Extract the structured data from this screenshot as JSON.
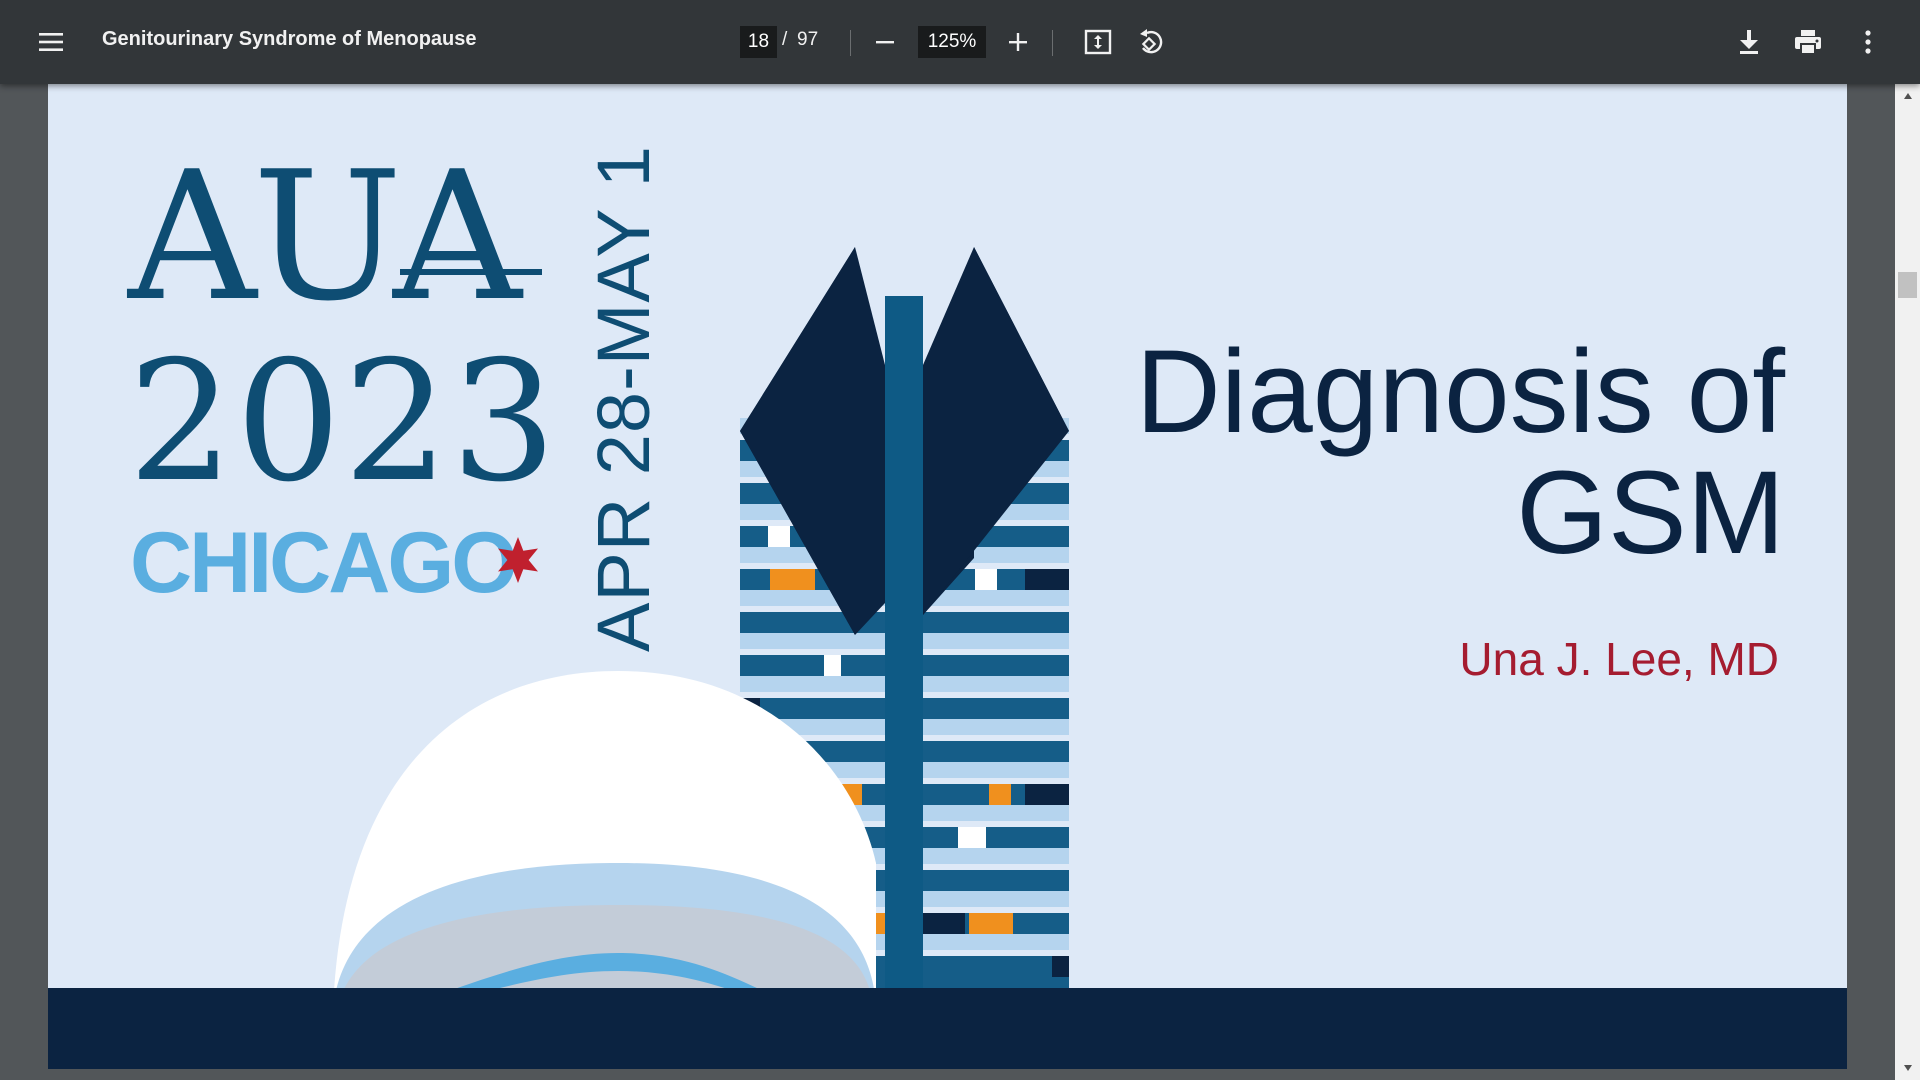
{
  "toolbar": {
    "document_title": "Genitourinary Syndrome of Menopause",
    "current_page": "18",
    "page_separator": "/",
    "total_pages": "97",
    "zoom_level": "125%",
    "icons": {
      "menu": "menu-icon",
      "zoom_out": "minus-icon",
      "zoom_in": "plus-icon",
      "fit_page": "fit-to-page-icon",
      "rotate": "rotate-icon",
      "download": "download-icon",
      "print": "print-icon",
      "more": "more-vertical-icon"
    },
    "colors": {
      "background": "#323639",
      "text": "#f1f1f1",
      "field": "#191b1c"
    }
  },
  "slide": {
    "logo_word": "AUA",
    "logo_year": "2023",
    "city": "CHICAGO",
    "dates": "APR 28-MAY 1",
    "title_line1": "Diagnosis of",
    "title_line2": "GSM",
    "author": "Una J. Lee, MD",
    "colors": {
      "background": "#dee9f7",
      "navy": "#0b2341",
      "logo_blue": "#0e4d73",
      "city_blue": "#5aaee0",
      "author_red": "#a51c30",
      "accent_orange": "#f0901e"
    }
  },
  "scrollbar": {
    "position": 0.18
  }
}
